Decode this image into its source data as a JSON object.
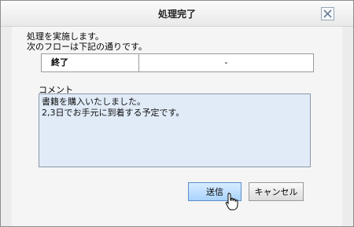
{
  "dialog": {
    "title": "処理完了",
    "close_icon": "close-icon"
  },
  "message": {
    "line1": "処理を実施します。",
    "line2": "次のフローは下記の通りです。"
  },
  "flow_table": {
    "key": "終了",
    "value": "-"
  },
  "comment": {
    "label": "コメント",
    "value": "書籍を購入いたしました。\n2,3日でお手元に到着する予定です。"
  },
  "buttons": {
    "send_label": "送信",
    "cancel_label": "キャンセル"
  },
  "cursor": {
    "icon": "hand-pointer-icon"
  }
}
